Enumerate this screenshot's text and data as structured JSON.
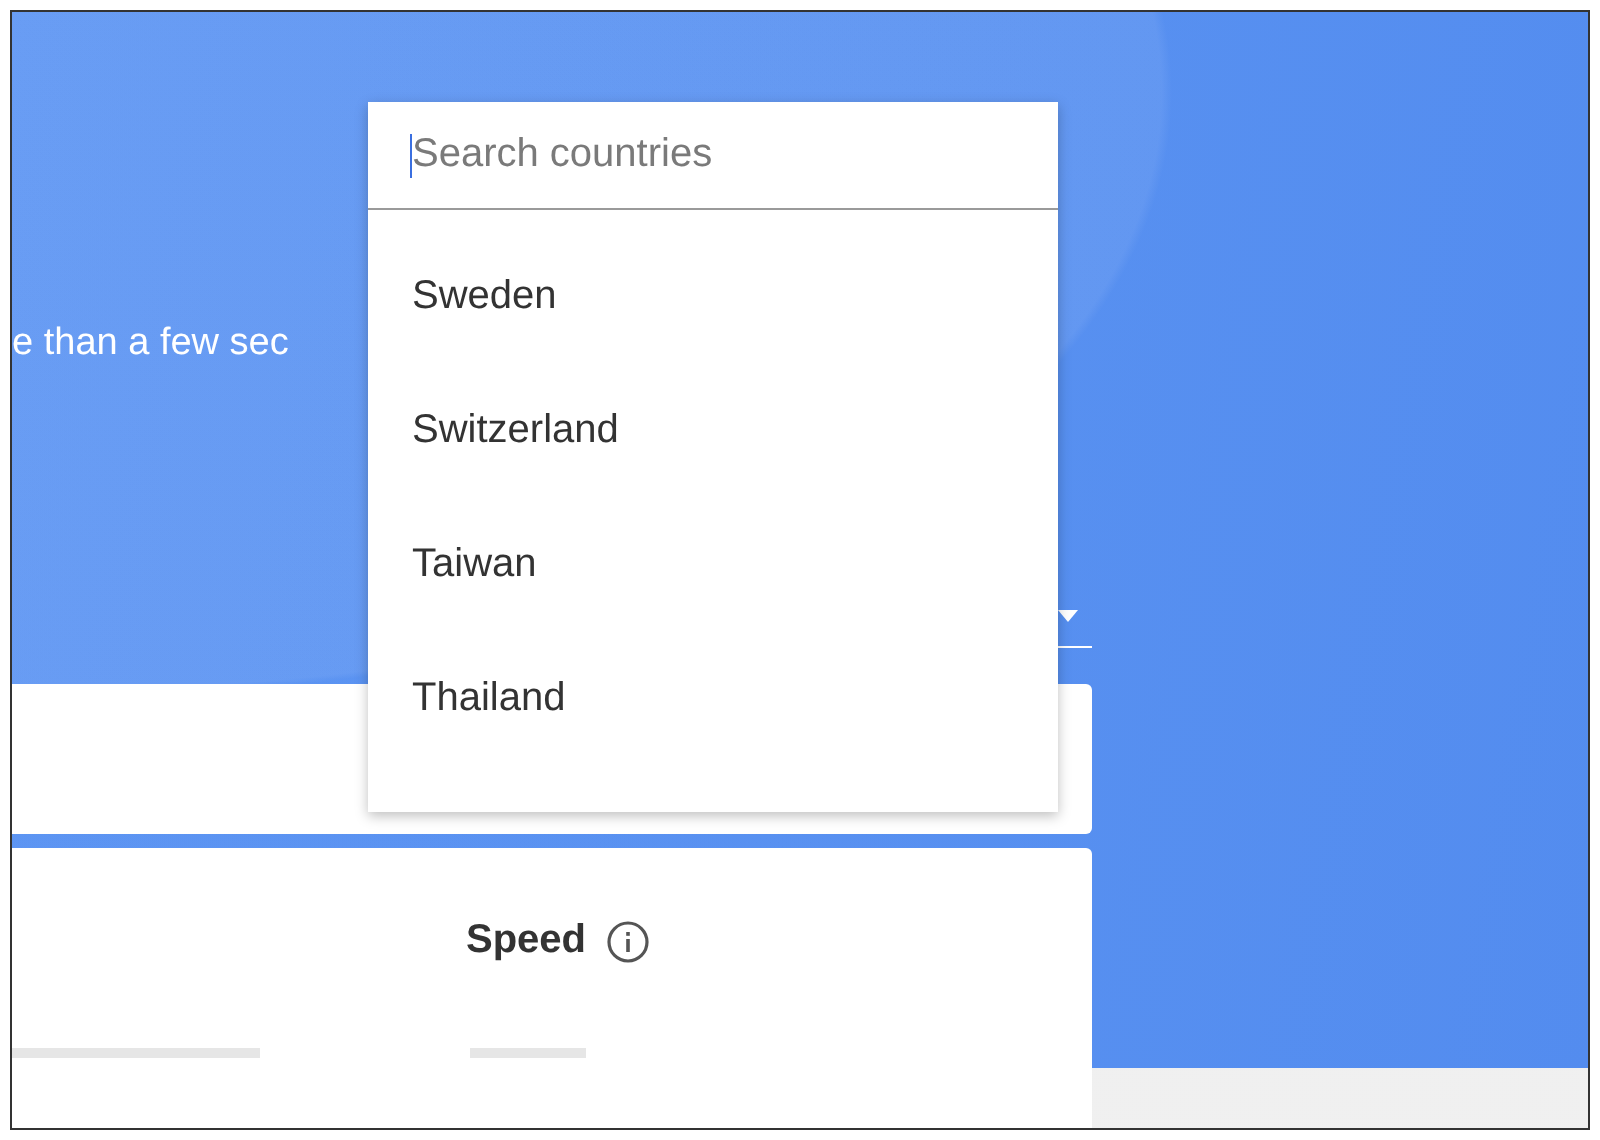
{
  "intro_text": "e than a few sec",
  "country_menu": {
    "search": {
      "placeholder": "Search countries"
    },
    "items": [
      {
        "label": "Sweden"
      },
      {
        "label": "Switzerland"
      },
      {
        "label": "Taiwan"
      },
      {
        "label": "Thailand"
      }
    ]
  },
  "speed_card": {
    "label": "Speed"
  }
}
